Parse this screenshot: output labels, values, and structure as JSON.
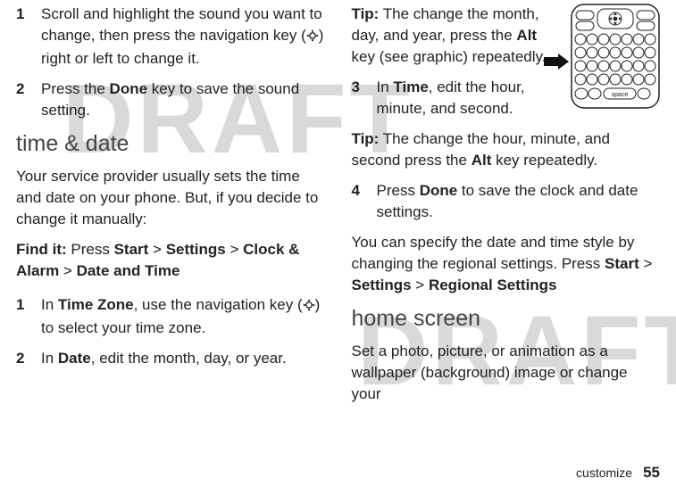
{
  "watermark": "DRAFT",
  "col_left": {
    "step1": {
      "num": "1",
      "a": "Scroll and highlight the sound you want to change, then press the navigation key (",
      "b": ") right or left to change it."
    },
    "step2": {
      "num": "2",
      "a": "Press the ",
      "done": "Done",
      "b": " key to save the sound setting."
    },
    "heading_time": "time & date",
    "intro": "Your service provider usually sets the time and date on your phone. But, if you decide to change it manually:",
    "findit": {
      "label": "Find it:",
      "press": " Press ",
      "start": "Start",
      "gt1": " >",
      "settings": "Settings",
      "gt2": " >",
      "clock": "Clock & Alarm",
      "gt3": " >",
      "dateandtime": "Date and Time"
    },
    "tz_step": {
      "num": "1",
      "a": "In ",
      "tz": "Time Zone",
      "b": ", use the navigation key (",
      "c": ") to select your time zone."
    },
    "date_step": {
      "num": "2",
      "a": "In ",
      "date": "Date",
      "b": ", edit the month, day, or year."
    }
  },
  "col_right": {
    "tip1": {
      "label": "Tip:",
      "a": " The change the month, day, and year, press the ",
      "alt": "Alt",
      "b": " key (see graphic) repeatedly."
    },
    "step3": {
      "num": "3",
      "a": "In ",
      "time": "Time",
      "b": ", edit the hour, minute, and second."
    },
    "tip2": {
      "label": "Tip:",
      "a": " The change the hour, minute, and second press the ",
      "alt": "Alt",
      "b": " key repeatedly."
    },
    "step4": {
      "num": "4",
      "a": "Press ",
      "done": "Done",
      "b": " to save the clock and date settings."
    },
    "para_regional": {
      "a": "You can specify the date and time style by changing the regional settings. Press ",
      "start": "Start",
      "gt1": " >",
      "settings": "Settings",
      "gt2": " >",
      "regional": "Regional Settings"
    },
    "heading_home": "home screen",
    "home_intro": "Set a photo, picture, or animation as a wallpaper (background) image or change your"
  },
  "keypad": {
    "keys_row1": "space"
  },
  "footer": {
    "section": "customize",
    "page": "55"
  }
}
